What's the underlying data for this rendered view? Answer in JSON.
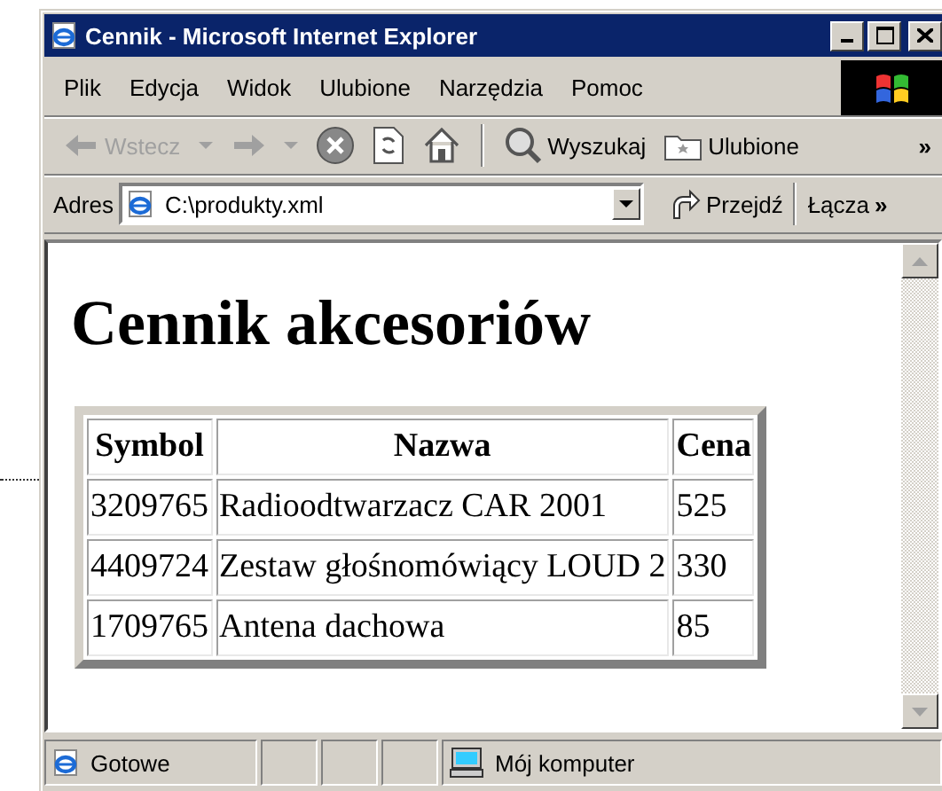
{
  "window": {
    "title": "Cennik - Microsoft Internet Explorer"
  },
  "menu": [
    {
      "label": "Plik"
    },
    {
      "label": "Edycja"
    },
    {
      "label": "Widok"
    },
    {
      "label": "Ulubione"
    },
    {
      "label": "Narzędzia"
    },
    {
      "label": "Pomoc"
    }
  ],
  "toolbar": [
    {
      "kind": "back",
      "label": "Wstecz",
      "disabled": true
    },
    {
      "kind": "forward",
      "disabled": true
    },
    {
      "kind": "stop",
      "disabled": false
    },
    {
      "kind": "refresh",
      "disabled": false
    },
    {
      "kind": "home",
      "disabled": false
    },
    {
      "kind": "separator"
    },
    {
      "kind": "search",
      "label": "Wyszukaj",
      "disabled": false
    },
    {
      "kind": "favorites",
      "label": "Ulubione",
      "disabled": false
    },
    {
      "kind": "more",
      "label": "»"
    }
  ],
  "address": {
    "label": "Adres",
    "value": "C:\\produkty.xml",
    "go_label": "Przejdź",
    "links_label": "Łącza",
    "more": "»"
  },
  "page": {
    "heading": "Cennik akcesoriów",
    "table": {
      "columns": [
        "Symbol",
        "Nazwa",
        "Cena"
      ],
      "rows": [
        [
          "3209765",
          "Radioodtwarzacz CAR 2001",
          "525"
        ],
        [
          "4409724",
          "Zestaw głośnomówiący LOUD 2",
          "330"
        ],
        [
          "1709765",
          "Antena dachowa",
          "85"
        ]
      ]
    }
  },
  "status_bar": {
    "text": "Gotowe",
    "zone": "Mój komputer"
  }
}
